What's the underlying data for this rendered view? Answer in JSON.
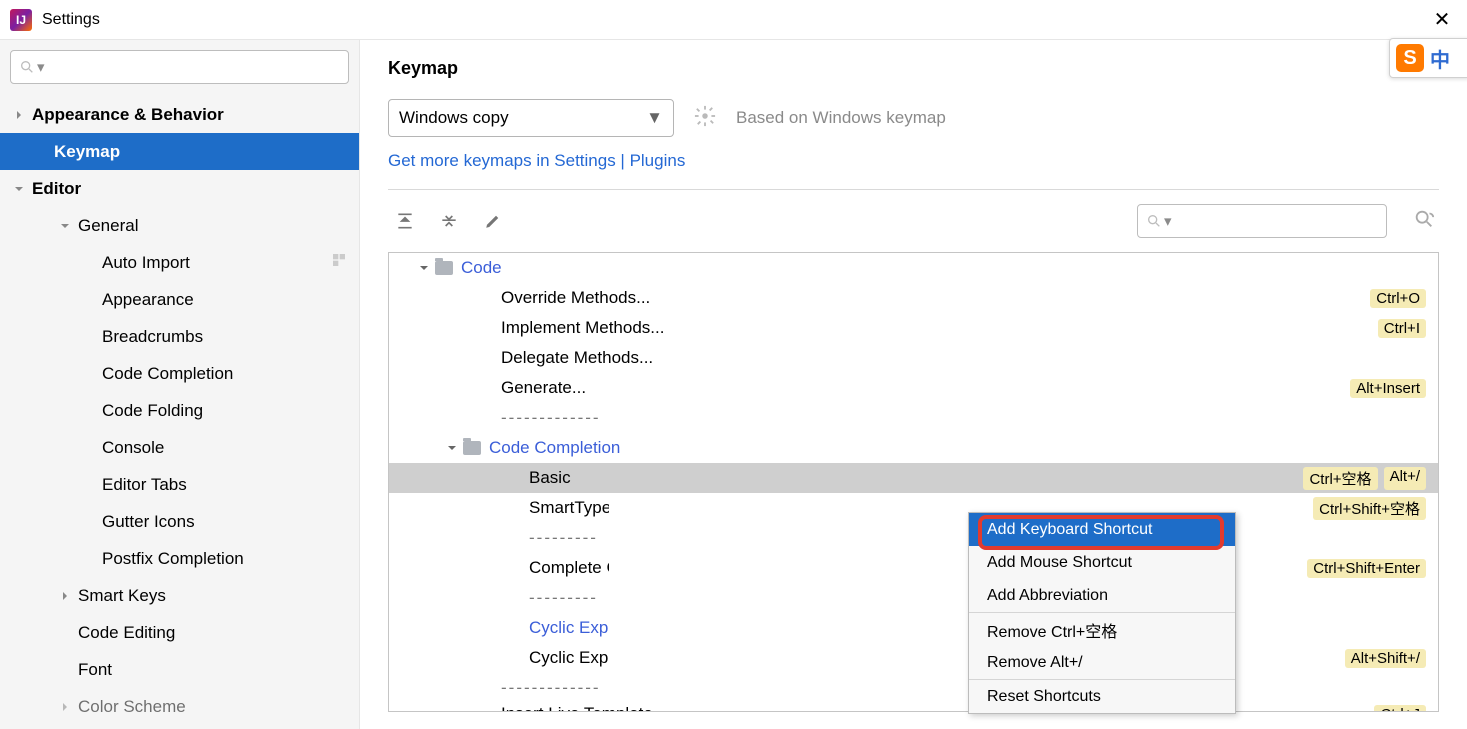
{
  "window": {
    "title": "Settings",
    "close_glyph": "✕"
  },
  "sidebar": {
    "items": [
      {
        "label": "Appearance & Behavior",
        "depth": 0,
        "expandable": true,
        "expanded": false,
        "bold": true
      },
      {
        "label": "Keymap",
        "depth": 1,
        "selected": true,
        "bold": true
      },
      {
        "label": "Editor",
        "depth": 0,
        "expandable": true,
        "expanded": true,
        "bold": true
      },
      {
        "label": "General",
        "depth": 2,
        "expandable": true,
        "expanded": true,
        "bold": false
      },
      {
        "label": "Auto Import",
        "depth": 3,
        "tail_icon": true
      },
      {
        "label": "Appearance",
        "depth": 3
      },
      {
        "label": "Breadcrumbs",
        "depth": 3
      },
      {
        "label": "Code Completion",
        "depth": 3
      },
      {
        "label": "Code Folding",
        "depth": 3
      },
      {
        "label": "Console",
        "depth": 3
      },
      {
        "label": "Editor Tabs",
        "depth": 3
      },
      {
        "label": "Gutter Icons",
        "depth": 3
      },
      {
        "label": "Postfix Completion",
        "depth": 3
      },
      {
        "label": "Smart Keys",
        "depth": 2,
        "expandable": true,
        "expanded": false
      },
      {
        "label": "Code Editing",
        "depth": 2
      },
      {
        "label": "Font",
        "depth": 2
      },
      {
        "label": "Color Scheme",
        "depth": 2,
        "expandable": true,
        "expanded": false,
        "dim": true
      }
    ]
  },
  "main": {
    "page_title": "Keymap",
    "dropdown_value": "Windows copy",
    "based_on": "Based on Windows keymap",
    "link_text": "Get more keymaps in Settings | Plugins",
    "tree": [
      {
        "type": "folder",
        "label": "Code",
        "indent": 28,
        "expanded": true
      },
      {
        "type": "action",
        "label": "Override Methods...",
        "indent": 112,
        "shortcuts": [
          "Ctrl+O"
        ]
      },
      {
        "type": "action",
        "label": "Implement Methods...",
        "indent": 112,
        "shortcuts": [
          "Ctrl+I"
        ]
      },
      {
        "type": "action",
        "label": "Delegate Methods...",
        "indent": 112,
        "shortcuts": []
      },
      {
        "type": "action",
        "label": "Generate...",
        "indent": 112,
        "shortcuts": [
          "Alt+Insert"
        ]
      },
      {
        "type": "divider",
        "label": "-------------",
        "indent": 112
      },
      {
        "type": "folder",
        "label": "Code Completion",
        "indent": 56,
        "expanded": true
      },
      {
        "type": "action",
        "label": "Basic",
        "indent": 140,
        "shortcuts": [
          "Ctrl+空格",
          "Alt+/"
        ],
        "selected": true
      },
      {
        "type": "action",
        "label": "SmartType",
        "indent": 140,
        "shortcuts": [
          "Ctrl+Shift+空格"
        ],
        "truncated": true
      },
      {
        "type": "divider",
        "label": "---------",
        "indent": 140,
        "truncated": true
      },
      {
        "type": "action",
        "label": "Complete Current...",
        "indent": 140,
        "shortcuts": [
          "Ctrl+Shift+Enter"
        ],
        "truncated": true
      },
      {
        "type": "divider",
        "label": "---------",
        "indent": 140,
        "truncated": true
      },
      {
        "type": "folder",
        "label": "Cyclic Expand...",
        "indent": 140,
        "link_style": true,
        "truncated": true
      },
      {
        "type": "action",
        "label": "Cyclic Expand...",
        "indent": 140,
        "shortcuts": [
          "Alt+Shift+/"
        ],
        "truncated": true
      },
      {
        "type": "divider",
        "label": "-------------",
        "indent": 112
      },
      {
        "type": "action",
        "label": "Insert Live Template...",
        "indent": 112,
        "shortcuts": [
          "Ctrl+J"
        ],
        "cut": true
      }
    ]
  },
  "context_menu": {
    "items": [
      {
        "label": "Add Keyboard Shortcut",
        "selected": true
      },
      {
        "label": "Add Mouse Shortcut"
      },
      {
        "label": "Add Abbreviation"
      },
      {
        "sep": true
      },
      {
        "label": "Remove Ctrl+空格"
      },
      {
        "label": "Remove Alt+/"
      },
      {
        "sep": true
      },
      {
        "label": "Reset Shortcuts"
      }
    ]
  },
  "ime": {
    "logo": "S",
    "lang": "中"
  }
}
